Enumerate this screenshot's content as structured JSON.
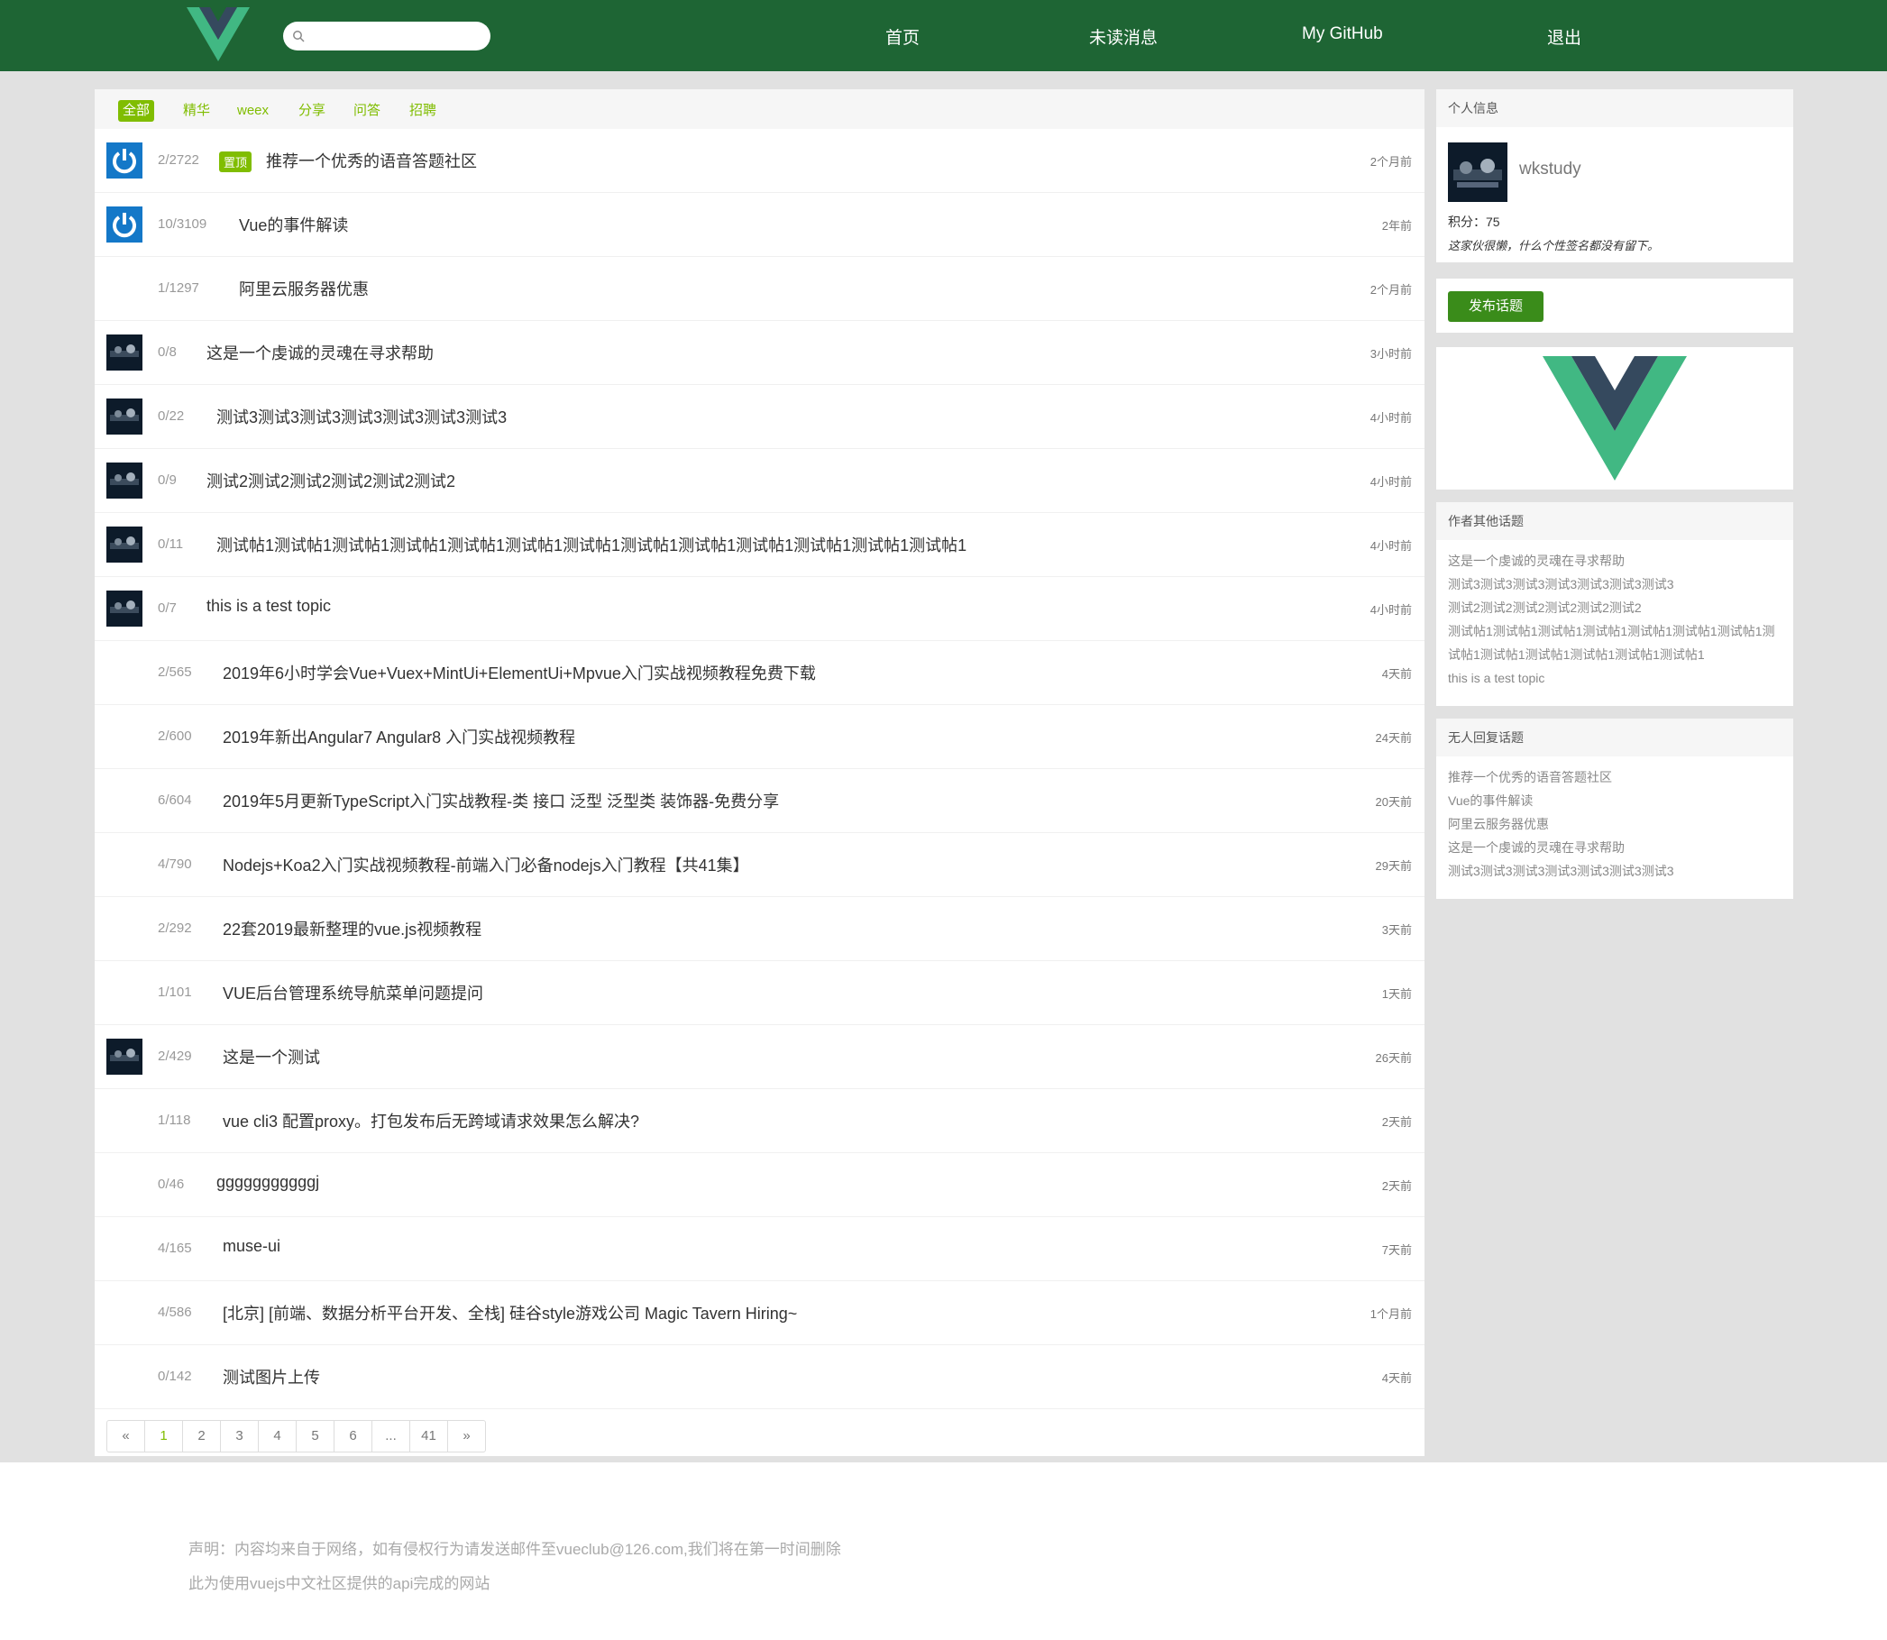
{
  "header": {
    "search_placeholder": "",
    "nav": [
      "首页",
      "未读消息",
      "My GitHub",
      "退出"
    ]
  },
  "tabs": [
    "全部",
    "精华",
    "weex",
    "分享",
    "问答",
    "招聘"
  ],
  "pin_label": "置顶",
  "topics": [
    {
      "avatar": "power",
      "count": "2/2722",
      "pinned": true,
      "title": "推荐一个优秀的语音答题社区",
      "time": "2个月前"
    },
    {
      "avatar": "power",
      "count": "10/3109",
      "pinned": false,
      "title": "Vue的事件解读",
      "time": "2年前"
    },
    {
      "avatar": "none",
      "count": "1/1297",
      "pinned": false,
      "title": "阿里云服务器优惠",
      "time": "2个月前"
    },
    {
      "avatar": "dark",
      "count": "0/8",
      "pinned": false,
      "title": "这是一个虔诚的灵魂在寻求帮助",
      "time": "3小时前"
    },
    {
      "avatar": "dark",
      "count": "0/22",
      "pinned": false,
      "title": "测试3测试3测试3测试3测试3测试3测试3",
      "time": "4小时前"
    },
    {
      "avatar": "dark",
      "count": "0/9",
      "pinned": false,
      "title": "测试2测试2测试2测试2测试2测试2",
      "time": "4小时前"
    },
    {
      "avatar": "dark",
      "count": "0/11",
      "pinned": false,
      "title": "测试帖1测试帖1测试帖1测试帖1测试帖1测试帖1测试帖1测试帖1测试帖1测试帖1测试帖1测试帖1测试帖1",
      "time": "4小时前"
    },
    {
      "avatar": "dark",
      "count": "0/7",
      "pinned": false,
      "title": "this is a test topic",
      "time": "4小时前"
    },
    {
      "avatar": "none",
      "count": "2/565",
      "pinned": false,
      "title": "2019年6小时学会Vue+Vuex+MintUi+ElementUi+Mpvue入门实战视频教程免费下载",
      "time": "4天前"
    },
    {
      "avatar": "none",
      "count": "2/600",
      "pinned": false,
      "title": "2019年新出Angular7 Angular8 入门实战视频教程",
      "time": "24天前"
    },
    {
      "avatar": "none",
      "count": "6/604",
      "pinned": false,
      "title": "2019年5月更新TypeScript入门实战教程-类 接口 泛型 泛型类 装饰器-免费分享",
      "time": "20天前"
    },
    {
      "avatar": "none",
      "count": "4/790",
      "pinned": false,
      "title": "Nodejs+Koa2入门实战视频教程-前端入门必备nodejs入门教程【共41集】",
      "time": "29天前"
    },
    {
      "avatar": "none",
      "count": "2/292",
      "pinned": false,
      "title": "22套2019最新整理的vue.js视频教程",
      "time": "3天前"
    },
    {
      "avatar": "none",
      "count": "1/101",
      "pinned": false,
      "title": "VUE后台管理系统导航菜单问题提问",
      "time": "1天前"
    },
    {
      "avatar": "dark",
      "count": "2/429",
      "pinned": false,
      "title": "这是一个测试",
      "time": "26天前"
    },
    {
      "avatar": "none",
      "count": "1/118",
      "pinned": false,
      "title": "vue cli3 配置proxy。打包发布后无跨域请求效果怎么解决?",
      "time": "2天前"
    },
    {
      "avatar": "none",
      "count": "0/46",
      "pinned": false,
      "title": "gggggggggggj",
      "time": "2天前"
    },
    {
      "avatar": "none",
      "count": "4/165",
      "pinned": false,
      "title": "muse-ui",
      "time": "7天前"
    },
    {
      "avatar": "none",
      "count": "4/586",
      "pinned": false,
      "title": "[北京] [前端、数据分析平台开发、全栈] 硅谷style游戏公司 Magic Tavern Hiring~",
      "time": "1个月前"
    },
    {
      "avatar": "none",
      "count": "0/142",
      "pinned": false,
      "title": "测试图片上传",
      "time": "4天前"
    }
  ],
  "pagination": [
    "«",
    "1",
    "2",
    "3",
    "4",
    "5",
    "6",
    "...",
    "41",
    "»"
  ],
  "pagination_current": "1",
  "sidebar": {
    "profile_title": "个人信息",
    "username": "wkstudy",
    "score": "积分：75",
    "signature": "这家伙很懒，什么个性签名都没有留下。",
    "publish_label": "发布话题",
    "author_topics_title": "作者其他话题",
    "author_topics": [
      "这是一个虔诚的灵魂在寻求帮助",
      "测试3测试3测试3测试3测试3测试3测试3",
      "测试2测试2测试2测试2测试2测试2",
      "测试帖1测试帖1测试帖1测试帖1测试帖1测试帖1测试帖1测试帖1测试帖1测试帖1测试帖1测试帖1测试帖1",
      "this is a test topic"
    ],
    "no_reply_title": "无人回复话题",
    "no_reply_topics": [
      "推荐一个优秀的语音答题社区",
      "Vue的事件解读",
      "阿里云服务器优惠",
      "这是一个虔诚的灵魂在寻求帮助",
      "测试3测试3测试3测试3测试3测试3测试3"
    ]
  },
  "footer": {
    "line1": "声明：内容均来自于网络，如有侵权行为请发送邮件至vueclub@126.com,我们将在第一时间删除",
    "line2": "此为使用vuejs中文社区提供的api完成的网站"
  },
  "colors": {
    "navbar": "#1e6534",
    "accent": "#80bd01",
    "publish": "#3a8c1a",
    "vue_green": "#41b883",
    "vue_dark": "#35495e"
  }
}
